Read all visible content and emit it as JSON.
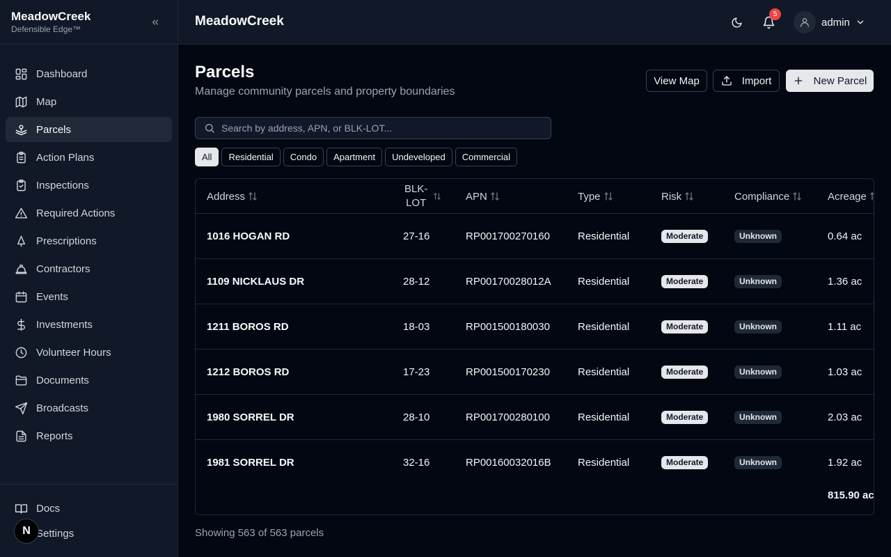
{
  "sidebar": {
    "brand_name": "MeadowCreek",
    "brand_sub": "Defensible Edge™",
    "items": [
      {
        "label": "Dashboard",
        "icon": "dashboard-icon"
      },
      {
        "label": "Map",
        "icon": "map-icon"
      },
      {
        "label": "Parcels",
        "icon": "parcels-icon",
        "active": true
      },
      {
        "label": "Action Plans",
        "icon": "clipboard-list-icon"
      },
      {
        "label": "Inspections",
        "icon": "clipboard-check-icon"
      },
      {
        "label": "Required Actions",
        "icon": "warning-icon"
      },
      {
        "label": "Prescriptions",
        "icon": "tree-icon"
      },
      {
        "label": "Contractors",
        "icon": "hard-hat-icon"
      },
      {
        "label": "Events",
        "icon": "calendar-icon"
      },
      {
        "label": "Investments",
        "icon": "dollar-icon"
      },
      {
        "label": "Volunteer Hours",
        "icon": "clock-icon"
      },
      {
        "label": "Documents",
        "icon": "folder-icon"
      },
      {
        "label": "Broadcasts",
        "icon": "send-icon"
      },
      {
        "label": "Reports",
        "icon": "report-icon"
      }
    ],
    "bottom_items": [
      {
        "label": "Docs",
        "icon": "book-icon"
      },
      {
        "label": "Settings",
        "icon": "settings-icon"
      }
    ],
    "next_badge": "N"
  },
  "header": {
    "title": "MeadowCreek",
    "notification_count": "5",
    "user_name": "admin"
  },
  "page": {
    "title": "Parcels",
    "subtitle": "Manage community parcels and property boundaries",
    "view_map_label": "View Map",
    "import_label": "Import",
    "new_parcel_label": "New Parcel",
    "search_placeholder": "Search by address, APN, or BLK-LOT...",
    "filters": [
      "All",
      "Residential",
      "Condo",
      "Apartment",
      "Undeveloped",
      "Commercial"
    ],
    "active_filter": "All"
  },
  "table": {
    "columns": {
      "address": "Address",
      "blk_lot_1": "BLK-",
      "blk_lot_2": "LOT",
      "apn": "APN",
      "type": "Type",
      "risk": "Risk",
      "compliance": "Compliance",
      "acreage": "Acreage"
    },
    "rows": [
      {
        "address": "1016 HOGAN RD",
        "blk_lot": "27-16",
        "apn": "RP001700270160",
        "type": "Residential",
        "risk": "Moderate",
        "compliance": "Unknown",
        "acreage": "0.64 ac"
      },
      {
        "address": "1109 NICKLAUS DR",
        "blk_lot": "28-12",
        "apn": "RP00170028012A",
        "type": "Residential",
        "risk": "Moderate",
        "compliance": "Unknown",
        "acreage": "1.36 ac"
      },
      {
        "address": "1211 BOROS RD",
        "blk_lot": "18-03",
        "apn": "RP001500180030",
        "type": "Residential",
        "risk": "Moderate",
        "compliance": "Unknown",
        "acreage": "1.11 ac"
      },
      {
        "address": "1212 BOROS RD",
        "blk_lot": "17-23",
        "apn": "RP001500170230",
        "type": "Residential",
        "risk": "Moderate",
        "compliance": "Unknown",
        "acreage": "1.03 ac"
      },
      {
        "address": "1980 SORREL DR",
        "blk_lot": "28-10",
        "apn": "RP001700280100",
        "type": "Residential",
        "risk": "Moderate",
        "compliance": "Unknown",
        "acreage": "2.03 ac"
      },
      {
        "address": "1981 SORREL DR",
        "blk_lot": "32-16",
        "apn": "RP00160032016B",
        "type": "Residential",
        "risk": "Moderate",
        "compliance": "Unknown",
        "acreage": "1.92 ac"
      }
    ],
    "total_acreage": "815.90 ac"
  },
  "footer": {
    "showing_text": "Showing 563 of 563 parcels"
  }
}
